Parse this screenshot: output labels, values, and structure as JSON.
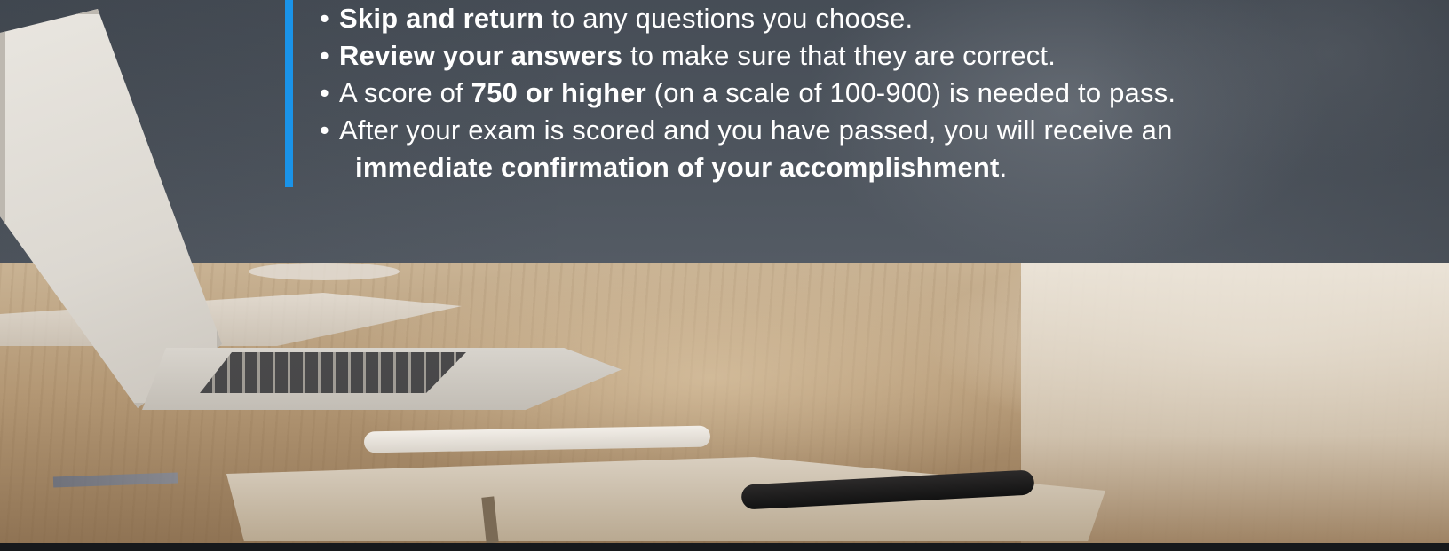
{
  "bullets": [
    {
      "bold": "Skip and return",
      "rest": " to any questions you choose."
    },
    {
      "bold": "Review your answers",
      "rest": " to make sure that they are correct."
    },
    {
      "lead": "A score of ",
      "bold": "750 or higher",
      "rest": " (on a scale of 100-900) is needed to pass."
    },
    {
      "lead": "After your exam is scored and you have passed, you will receive an",
      "bold": "immediate confirmation of your accomplishment",
      "rest": "."
    }
  ],
  "colors": {
    "accent_bar": "#1a93e8",
    "text": "#ffffff",
    "panel": "#4b525b"
  }
}
